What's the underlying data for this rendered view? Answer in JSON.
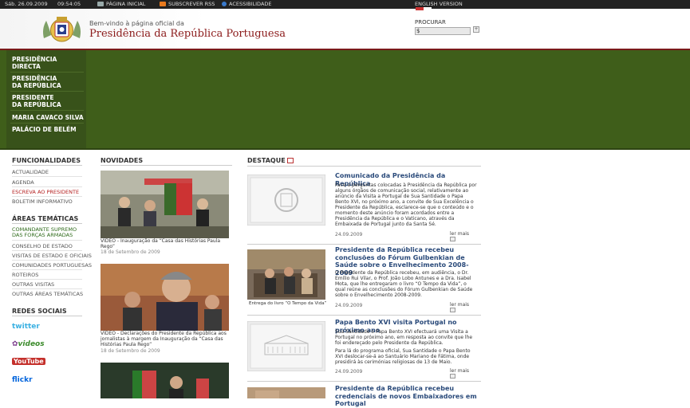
{
  "topbar": {
    "date": "Sáb. 26.09.2009",
    "time": "09:54:05",
    "home": "PÁGINA INICIAL",
    "rss": "SUBSCREVER RSS",
    "accessibility": "ACESSIBILIDADE",
    "english": "ENGLISH VERSION"
  },
  "header": {
    "welcome": "Bem-vindo à página oficial da",
    "title": "Presidência da República Portuguesa",
    "search_label": "PROCURAR",
    "search_value": "$"
  },
  "mainnav": [
    "PRESIDÊNCIA\nDIRECTA",
    "PRESIDÊNCIA\nda REPÚBLICA",
    "PRESIDENTE\nda REPÚBLICA",
    "MARIA CAVACO SILVA",
    "PALÁCIO de BELÉM"
  ],
  "sidebar": {
    "funcionalidades_title": "FUNCIONALIDADES",
    "funcionalidades": [
      "ACTUALIDADE",
      "AGENDA",
      "ESCREVA AO PRESIDENTE",
      "BOLETIM INFORMATIVO"
    ],
    "areas_title": "ÁREAS TEMÁTICAS",
    "areas": [
      "COMANDANTE SUPREMO\nDAS FORÇAS ARMADAS",
      "CONSELHO DE ESTADO",
      "VISITAS DE ESTADO E OFICIAIS",
      "COMUNIDADES PORTUGUESAS",
      "ROTEIROS",
      "OUTRAS VISITAS",
      "OUTRAS ÁREAS TEMÁTICAS"
    ],
    "social_title": "REDES SOCIAIS",
    "social": [
      "twitter",
      "videos",
      "YouTube",
      "flickr"
    ]
  },
  "novidades": {
    "title": "NOVIDADES",
    "items": [
      {
        "caption": "VÍDEO - Inauguração da “Casa das Histórias Paula Rego”",
        "date": "18 de Setembro de 2009"
      },
      {
        "caption": "VÍDEO - Declarações do Presidente da República aos jornalistas à margem da Inauguração da “Casa das Histórias Paula Rego”",
        "date": "18 de Setembro de 2009"
      }
    ]
  },
  "destaque": {
    "title": "DESTAQUE",
    "more_label": "ler mais",
    "items": [
      {
        "title": "Comunicado da Presidência da República",
        "body": "Face a perguntas colocadas à Presidência da República por alguns órgãos de comunicação social, relativamente ao anúncio da Visita a Portugal de Sua Santidade o Papa Bento XVI, no próximo ano, a convite de Sua Excelência o Presidente da República, esclarece-se que o conteúdo e o momento deste anúncio foram acordados entre a Presidência da República e o Vaticano, através da Embaixada de Portugal junto da Santa Sé.",
        "date": "24.09.2009",
        "thumb_caption": ""
      },
      {
        "title": "Presidente da República recebeu conclusões do Fórum Gulbenkian de Saúde sobre o Envelhecimento 2008-2009",
        "body": "O Presidente da República recebeu, em audiência, o Dr. Emílio Rui Vilar, o Prof. João Lobo Antunes e a Dra. Isabel Mota, que lhe entregaram o livro “O Tempo da Vida”, o qual reúne as conclusões do Fórum Gulbenkian de Saúde sobre o Envelhecimento 2008-2009.",
        "date": "24.09.2009",
        "thumb_caption": "Entrega do livro “O Tempo da Vida”"
      },
      {
        "title": "Papa Bento XVI visita Portugal no próximo ano",
        "body": "Sua Santidade o Papa Bento XVI efectuará uma Visita a Portugal no próximo ano, em resposta ao convite que lhe foi endereçado pelo Presidente da República.",
        "body2": "Para lá do programa oficial, Sua Santidade o Papa Bento XVI deslocar-se-á ao Santuário Mariano de Fátima, onde presidirá às cerimónias religiosas de 13 de Maio.",
        "date": "24.09.2009",
        "thumb_caption": ""
      },
      {
        "title": "Presidente da República recebeu credenciais de novos Embaixadores em Portugal",
        "body": "",
        "date": "",
        "thumb_caption": ""
      }
    ]
  },
  "colors": {
    "green": "#3f5e1a",
    "dark_green": "#38521a",
    "title_red": "#8b1a1a",
    "link_blue": "#2a4a7a"
  }
}
